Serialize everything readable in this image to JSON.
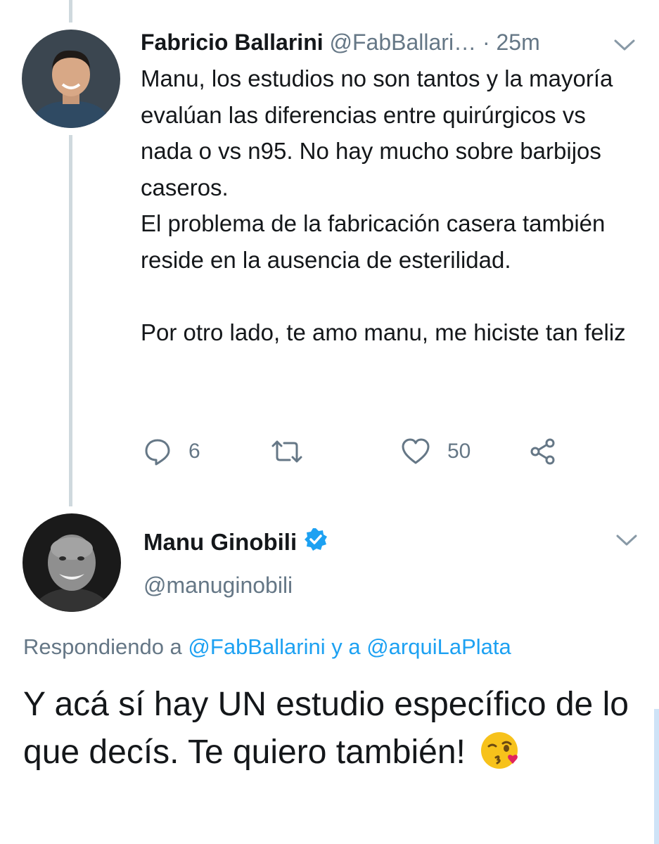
{
  "tweet": {
    "author_name": "Fabricio Ballarini",
    "author_handle": "@FabBallari…",
    "separator": "·",
    "time": "25m",
    "text": "Manu, los estudios no son tantos y la mayoría evalúan las diferencias entre quirúrgicos vs nada o vs n95. No hay mucho sobre barbijos caseros.\nEl problema de la fabricación casera también reside en la ausencia de esterilidad.\n\nPor otro lado, te amo manu, me hiciste tan feliz",
    "reply_count": "6",
    "retweet_count": "",
    "like_count": "50"
  },
  "reply": {
    "author_name": "Manu Ginobili",
    "author_handle": "@manuginobili",
    "replying_prefix": "Respondiendo a",
    "replying_user1": "@FabBallarini",
    "replying_conjunction": "y a",
    "replying_user2": "@arquiLaPlata",
    "text": "Y acá sí hay UN estudio específico de lo que decís. Te quiero también!"
  },
  "icons": {
    "reply": "speech-bubble-icon",
    "retweet": "retweet-icon",
    "like": "heart-icon",
    "share": "share-icon",
    "more": "chevron-down-icon",
    "verified": "verified-badge-icon",
    "emoji": "face-blowing-kiss-emoji"
  },
  "colors": {
    "link": "#1da1f2",
    "secondary_text": "#657786",
    "thread_line": "#cfd9de",
    "verified": "#1da1f2"
  }
}
